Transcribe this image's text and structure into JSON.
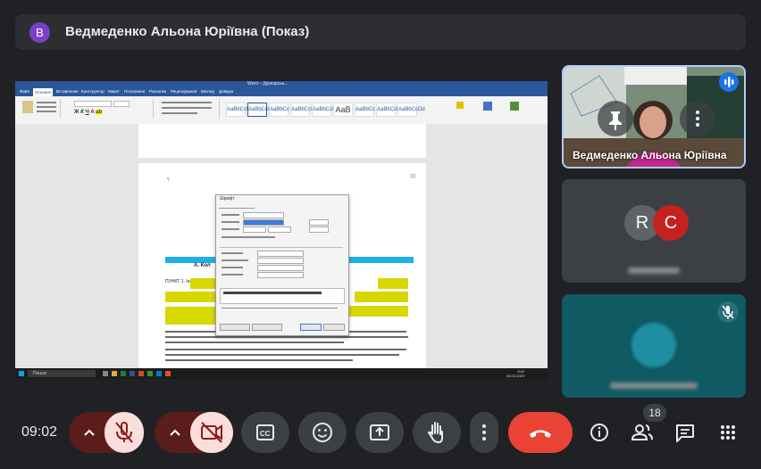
{
  "presenter": {
    "avatar_letter": "В",
    "title": "Ведмеденко Альона Юріївна (Показ)"
  },
  "shared_screen": {
    "window_title": "Word – Друкарськ…",
    "ribbon_tabs": [
      "Файл",
      "Основне",
      "Вставлення",
      "Конструктор",
      "Макет",
      "Посилання",
      "Розсилки",
      "Рецензування",
      "Вигляд",
      "Довідка"
    ],
    "active_tab": "Основне",
    "styles": [
      "AaBbCcDd",
      "AaBbCcDd",
      "AaBbCc",
      "AaBbCcI",
      "AaB"
    ],
    "dialog_title": "Шрифт",
    "doc_heading": "А. Кол",
    "doc_text_sample": "ПУНКТ 1. Інформація",
    "taskbar_search": "Пошук",
    "taskbar_time": "9:02",
    "taskbar_date": "26.02.2023"
  },
  "participants": [
    {
      "name": "Ведмеденко Альона Юріївна",
      "pinned": true,
      "speaking": true
    },
    {
      "name": "",
      "avatars": [
        "R",
        "C"
      ],
      "avatar_colors": [
        "#5f6368",
        "#c5221f"
      ]
    },
    {
      "name": "",
      "muted": true
    }
  ],
  "controls": {
    "time": "09:02",
    "participants_count": "18",
    "icons": [
      "mic-off-icon",
      "camera-off-icon",
      "captions-icon",
      "emoji-icon",
      "present-icon",
      "raise-hand-icon",
      "more-vert-icon",
      "end-call-icon",
      "info-icon",
      "people-icon",
      "chat-icon",
      "apps-icon"
    ]
  },
  "colors": {
    "background": "#202124",
    "end_call": "#ea4335",
    "muted_pill": "#5b1c1c",
    "muted_btn": "#f9dedc"
  }
}
